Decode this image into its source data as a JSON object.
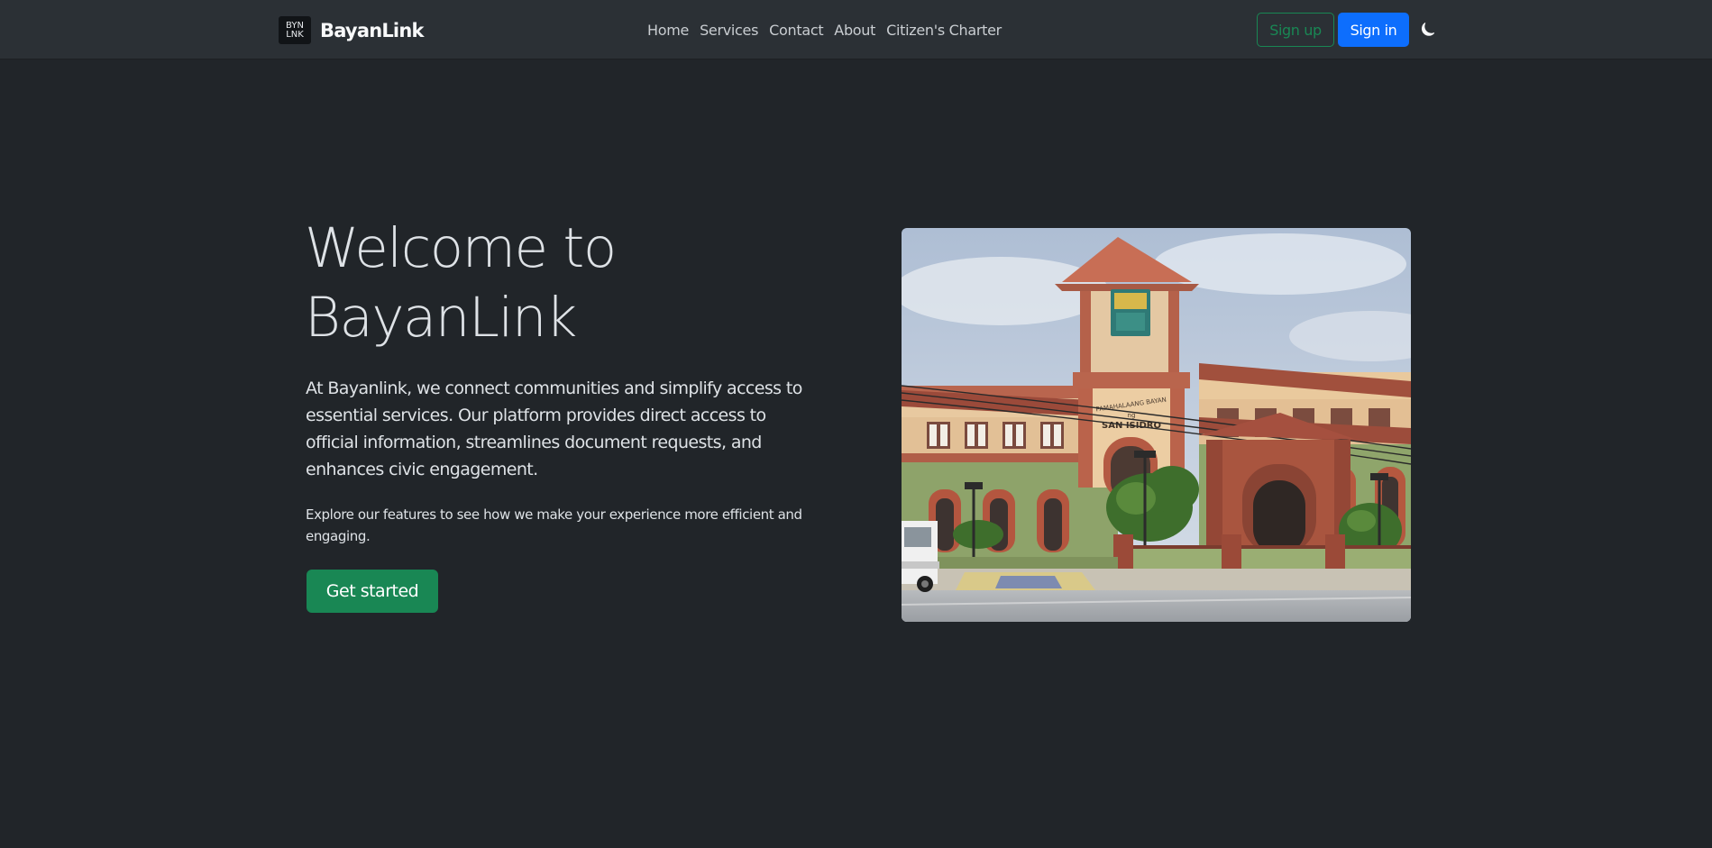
{
  "navbar": {
    "logo_line1": "BYN",
    "logo_line2": "LNK",
    "brand_name": "BayanLink",
    "links": [
      "Home",
      "Services",
      "Contact",
      "About",
      "Citizen's Charter"
    ],
    "signup_label": "Sign up",
    "signin_label": "Sign in",
    "theme_icon": "moon-icon"
  },
  "hero": {
    "title_line1": "Welcome to",
    "title_line2": "BayanLink",
    "lead": "At Bayanlink, we connect communities and simplify access to essential services. Our platform provides direct access to official information, streamlines document requests, and enhances civic engagement.",
    "sub": "Explore our features to see how we make your experience more efficient and engaging.",
    "cta_label": "Get started",
    "image": {
      "sign_line1": "PAMAHALAANG BAYAN",
      "sign_line2": "ng",
      "sign_line3": "SAN ISIDRO"
    }
  },
  "colors": {
    "background": "#212529",
    "navbar": "#2b3035",
    "success": "#198754",
    "primary": "#0d6efd"
  }
}
